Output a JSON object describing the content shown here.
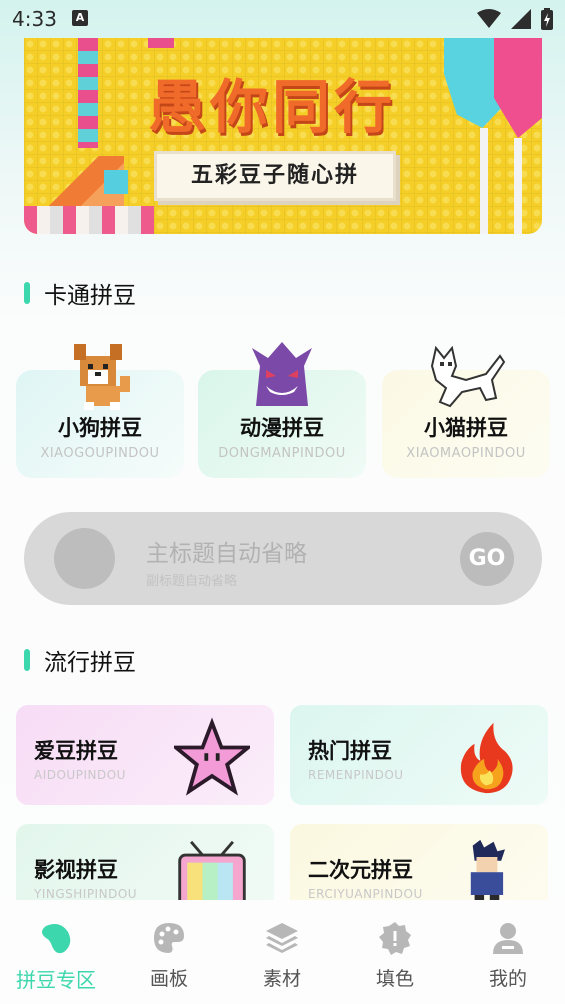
{
  "status_bar": {
    "time": "4:33",
    "notification_icon": "A"
  },
  "banner": {
    "title": "愚你同行",
    "subtitle": "五彩豆子随心拼"
  },
  "cartoon_section": {
    "title": "卡通拼豆",
    "cards": [
      {
        "name": "小狗拼豆",
        "pinyin": "XIAOGOUPINDOU",
        "icon": "dog-icon"
      },
      {
        "name": "动漫拼豆",
        "pinyin": "DONGMANPINDOU",
        "icon": "ghost-icon"
      },
      {
        "name": "小猫拼豆",
        "pinyin": "XIAOMAOPINDOU",
        "icon": "cat-icon"
      }
    ]
  },
  "promo": {
    "main": "主标题自动省略",
    "sub": "副标题自动省略",
    "go": "GO"
  },
  "popular_section": {
    "title": "流行拼豆",
    "cards": [
      {
        "name": "爱豆拼豆",
        "pinyin": "AIDOUPINDOU",
        "icon": "star-icon"
      },
      {
        "name": "热门拼豆",
        "pinyin": "REMENPINDOU",
        "icon": "fire-icon"
      },
      {
        "name": "影视拼豆",
        "pinyin": "YINGSHIPINDOU",
        "icon": "tv-icon"
      },
      {
        "name": "二次元拼豆",
        "pinyin": "ERCIYUANPINDOU",
        "icon": "anime-character-icon"
      }
    ]
  },
  "bottom_nav": {
    "items": [
      {
        "label": "拼豆专区",
        "icon": "bean-icon",
        "active": true
      },
      {
        "label": "画板",
        "icon": "palette-icon",
        "active": false
      },
      {
        "label": "素材",
        "icon": "layers-icon",
        "active": false
      },
      {
        "label": "填色",
        "icon": "fill-badge-icon",
        "active": false
      },
      {
        "label": "我的",
        "icon": "profile-icon",
        "active": false
      }
    ]
  },
  "colors": {
    "accent": "#3dd7ad",
    "banner_yellow": "#f5cf27",
    "banner_title": "#f06a2a"
  }
}
